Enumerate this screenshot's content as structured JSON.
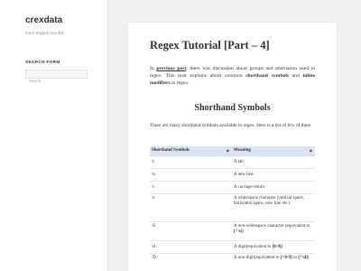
{
  "site": {
    "title": "crexdata",
    "description": "more English less BS"
  },
  "sidebar": {
    "search_title": "SEARCH FORM",
    "search_placeholder": "Search ..."
  },
  "article": {
    "title": "Regex Tutorial [Part – 4]",
    "intro": {
      "t1": "In ",
      "link": "previous post",
      "t2": ", there was discussion about groups and alternation used in regex. This post explains about common ",
      "b1": "shorthand symbols",
      "t3": " and ",
      "b2": "inline modifiers",
      "t4": " in regex."
    },
    "section_title": "Shorthand Symbols",
    "lead": "There are many shorthand symbols available in regex. Here is a list of few of them",
    "table": {
      "headers": [
        "Shorthand Symbols",
        "Meaning"
      ],
      "sort_icon": "◆",
      "rows": [
        {
          "symbol": "\\t",
          "meaning": "A tab"
        },
        {
          "symbol": "\\n",
          "meaning": "A new line"
        },
        {
          "symbol": "\\r",
          "meaning": "A carriage return"
        },
        {
          "symbol": "\\s",
          "meaning": "A whitespace character (vertical space, horizontal space, new line etc.)"
        },
        {
          "symbol": "\\S",
          "meaning_pre": "A non-whitespace character (equivalent to ",
          "meaning_code": "[^\\s]",
          "meaning_post": ")"
        },
        {
          "symbol": "\\d",
          "meaning_pre": "A digit(equivalent to ",
          "meaning_code": "[0-9]",
          "meaning_post": ")"
        },
        {
          "symbol": "\\D",
          "meaning_pre": "A non-digit(equivalent to ",
          "meaning_code": "[^0-9]",
          "meaning_mid": " or ",
          "meaning_code2": "[^\\d]",
          "meaning_post": ")"
        }
      ]
    }
  },
  "colors": {
    "background": "#f1f1f1",
    "header_bg": "#dbe4f0",
    "text": "#333333"
  }
}
